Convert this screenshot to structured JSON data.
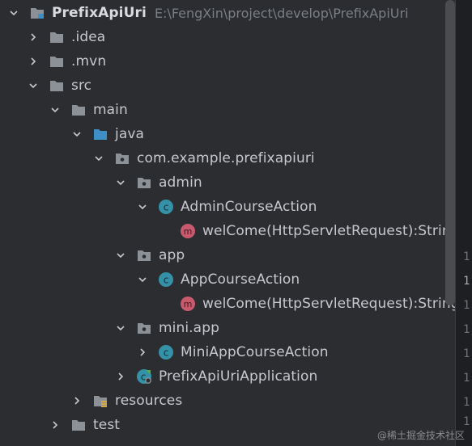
{
  "project": {
    "name": "PrefixApiUri",
    "path": "E:\\FengXin\\project\\develop\\PrefixApiUri"
  },
  "tree": {
    "idea": ".idea",
    "mvn": ".mvn",
    "src": "src",
    "main": "main",
    "java": "java",
    "package": "com.example.prefixapiuri",
    "admin": "admin",
    "admin_class": "AdminCourseAction",
    "admin_method": "welCome(HttpServletRequest):String",
    "app": "app",
    "app_class": "AppCourseAction",
    "app_method": "welCome(HttpServletRequest):String",
    "miniapp": "mini.app",
    "miniapp_class": "MiniAppCourseAction",
    "application": "PrefixApiUriApplication",
    "resources": "resources",
    "test": "test"
  },
  "gutter": {
    "line_numbers": [
      "1",
      "1",
      "1",
      "1",
      "1",
      "1",
      "1",
      "1"
    ]
  },
  "watermark": "@稀土掘金技术社区",
  "colors": {
    "background": "#2b2d30",
    "folder": "#8b9196",
    "java_folder": "#3d8fc6",
    "class_icon": "#3591a8",
    "method_icon": "#c95a6e",
    "text": "#c6c8ce",
    "path_text": "#7a7e85"
  }
}
